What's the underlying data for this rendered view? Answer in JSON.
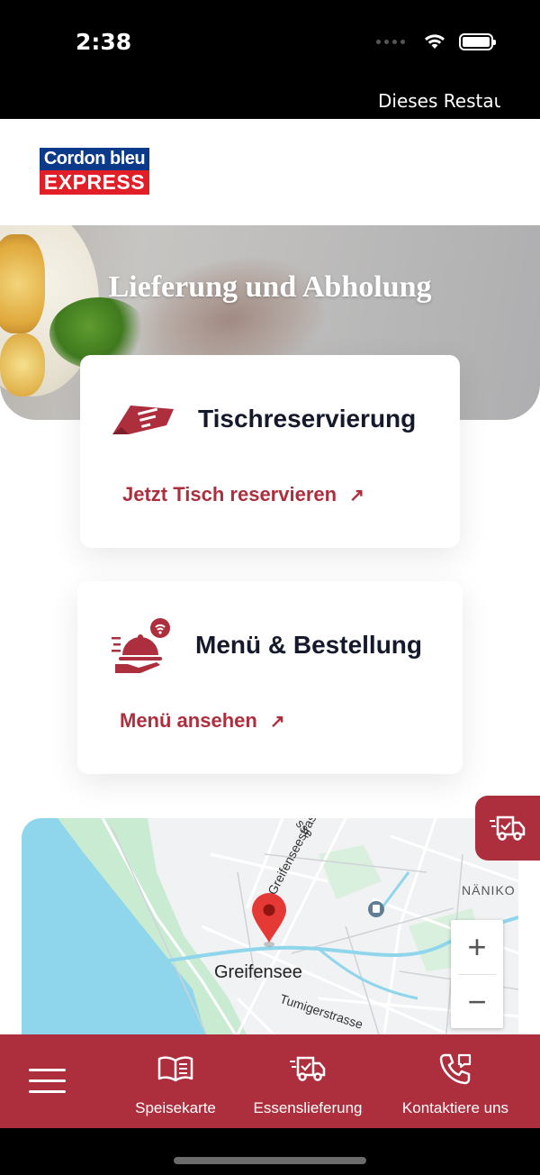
{
  "status_bar": {
    "time": "2:38"
  },
  "ticker": {
    "text": "Dieses Restau"
  },
  "logo": {
    "line1": "Cordon bleu",
    "line2": "EXPRESS"
  },
  "hero": {
    "title": "Lieferung und Abholung"
  },
  "cards": [
    {
      "title": "Tischreservierung",
      "link": "Jetzt Tisch reservieren",
      "icon": "ticket-icon"
    },
    {
      "title": "Menü & Bestellung",
      "link": "Menü ansehen",
      "icon": "cloche-icon"
    }
  ],
  "map": {
    "labels": {
      "town": "Greifensee",
      "street1": "Greifenseestrasse",
      "street2": "Tumigerstrasse",
      "nanikon": "NÄNIKO",
      "top_fragment": "sse"
    },
    "zoom_in": "+",
    "zoom_out": "−"
  },
  "bottom_nav": {
    "items": [
      {
        "label": "Speisekarte",
        "icon": "book-icon"
      },
      {
        "label": "Essenslieferung",
        "icon": "delivery-truck-icon"
      },
      {
        "label": "Kontaktiere uns",
        "icon": "phone-icon"
      }
    ]
  },
  "colors": {
    "brand_red": "#ad2f3e",
    "title_dark": "#141a2b",
    "logo_blue": "#0b3a8a",
    "logo_red": "#e21e26"
  }
}
